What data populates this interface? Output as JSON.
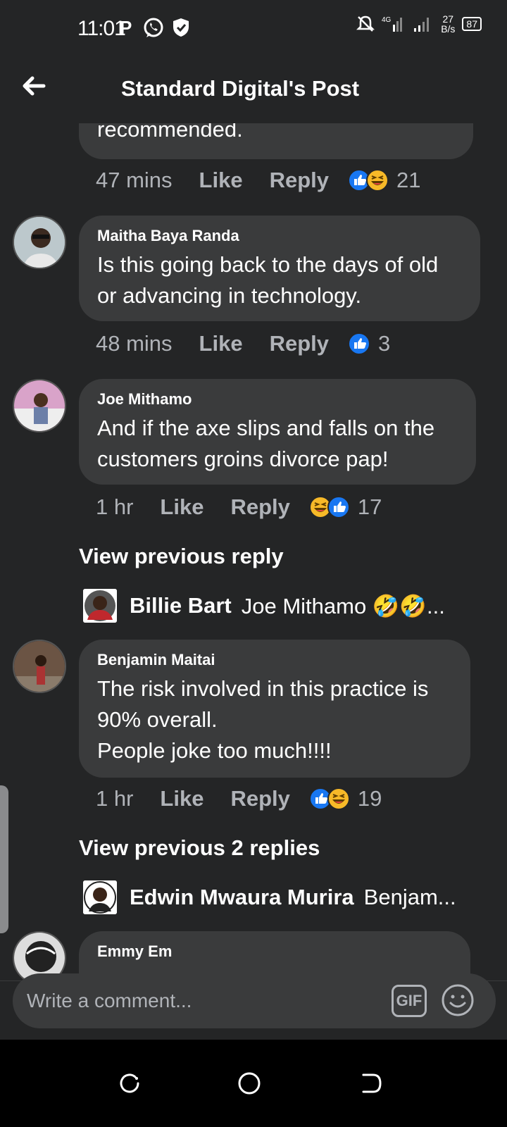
{
  "status_bar": {
    "time": "11:01",
    "network_speed_value": "27",
    "network_speed_unit": "B/s",
    "battery": "87"
  },
  "header": {
    "title": "Standard Digital's Post"
  },
  "comments": [
    {
      "author": "",
      "text": "recommended.",
      "time": "47 mins",
      "like_label": "Like",
      "reply_label": "Reply",
      "reactions": [
        "like",
        "haha"
      ],
      "reaction_count": "21"
    },
    {
      "author": "Maitha Baya Randa",
      "text": "Is this going back to the days of old\nor advancing in technology.",
      "time": "48 mins",
      "like_label": "Like",
      "reply_label": "Reply",
      "reactions": [
        "like"
      ],
      "reaction_count": "3"
    },
    {
      "author": "Joe Mithamo",
      "text": "And if the axe slips and falls on the\ncustomers groins divorce pap!",
      "time": "1 hr",
      "like_label": "Like",
      "reply_label": "Reply",
      "reactions": [
        "haha",
        "like"
      ],
      "reaction_count": "17",
      "view_previous": "View previous reply",
      "latest_reply": {
        "name": "Billie Bart",
        "text": "Joe Mithamo 🤣🤣..."
      }
    },
    {
      "author": "Benjamin Maitai",
      "text": "The risk involved in this practice is\n90% overall.\nPeople joke too much!!!!",
      "time": "1 hr",
      "like_label": "Like",
      "reply_label": "Reply",
      "reactions": [
        "like",
        "haha"
      ],
      "reaction_count": "19",
      "view_previous": "View previous 2 replies",
      "latest_reply": {
        "name": "Edwin Mwaura Murira",
        "text": "Benjam..."
      }
    },
    {
      "author": "Emmy Em"
    }
  ],
  "composer": {
    "placeholder": "Write a comment...",
    "gif_label": "GIF"
  },
  "colors": {
    "background": "#242526",
    "bubble": "#3a3b3c",
    "meta_text": "#b0b3b8",
    "like_blue": "#1877f2",
    "haha_yellow": "#f7b928"
  },
  "icons": {
    "back": "arrow-left-icon",
    "like_reaction": "like-reaction-icon",
    "haha_reaction": "haha-reaction-icon",
    "emoji": "smiley-icon",
    "nav_recents": "recents-icon",
    "nav_home": "home-icon",
    "nav_back": "nav-back-icon"
  }
}
